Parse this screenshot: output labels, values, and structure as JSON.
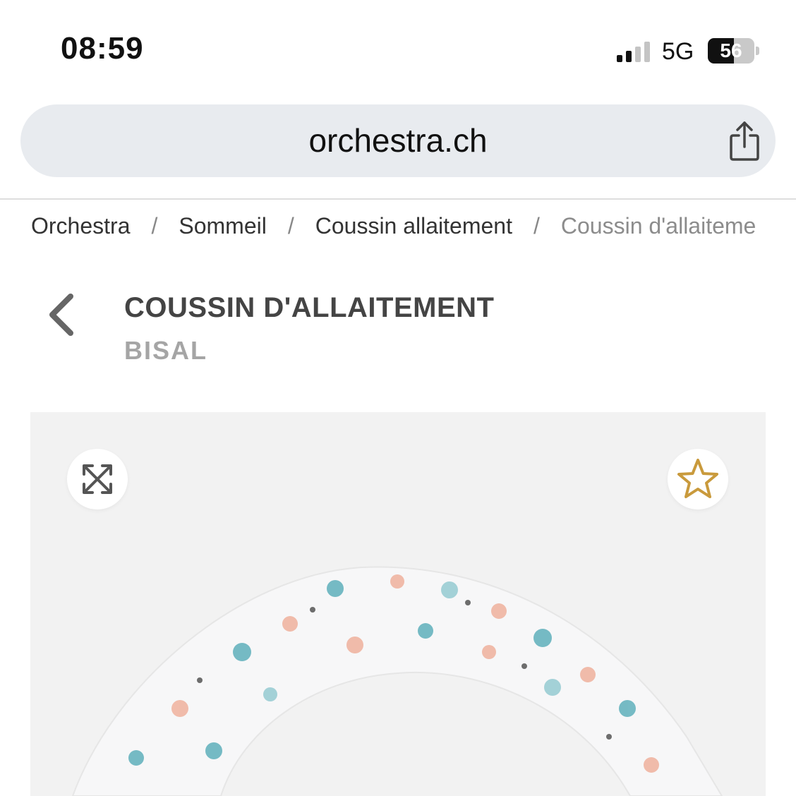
{
  "status_bar": {
    "time": "08:59",
    "network": "5G",
    "battery": "56",
    "battery_level": 0.56
  },
  "browser": {
    "url": "orchestra.ch"
  },
  "breadcrumb": {
    "items": [
      "Orchestra",
      "Sommeil",
      "Coussin allaitement"
    ],
    "separator": "/",
    "current": "Coussin d'allaiteme"
  },
  "product": {
    "title": "COUSSIN D'ALLAITEMENT",
    "brand": "BISAL"
  },
  "icons": {
    "back": "chevron-left-icon",
    "share": "share-icon",
    "expand": "expand-icon",
    "favorite": "star-outline-icon"
  },
  "colors": {
    "url_bar_bg": "#e8ebef",
    "image_panel_bg": "#f2f2f2",
    "star_accent": "#c99a3c",
    "title_text": "#444444",
    "brand_text": "#a5a5a5",
    "pillow_teal": "#6fb7c2",
    "pillow_pink": "#f0b8a6"
  }
}
